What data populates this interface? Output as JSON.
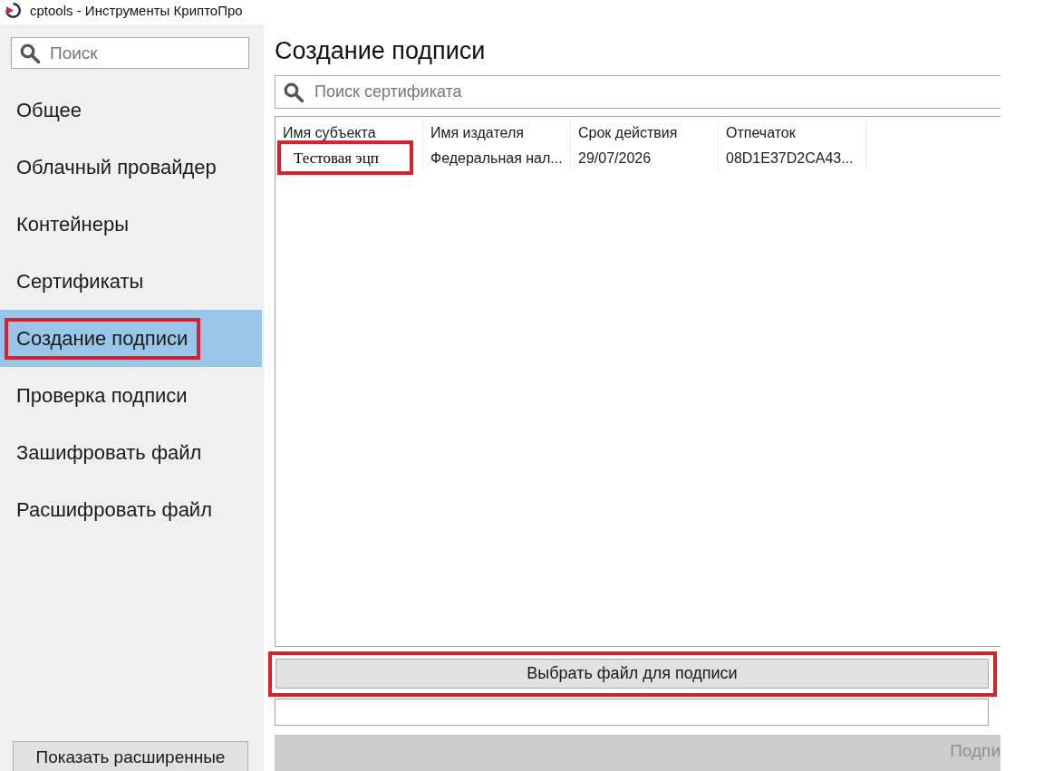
{
  "window": {
    "title": "cptools - Инструменты КриптоПро"
  },
  "sidebar": {
    "search": {
      "placeholder": "Поиск"
    },
    "items": [
      {
        "label": "Общее",
        "selected": false,
        "highlighted": false
      },
      {
        "label": "Облачный провайдер",
        "selected": false,
        "highlighted": false
      },
      {
        "label": "Контейнеры",
        "selected": false,
        "highlighted": false
      },
      {
        "label": "Сертификаты",
        "selected": false,
        "highlighted": false
      },
      {
        "label": "Создание подписи",
        "selected": true,
        "highlighted": true
      },
      {
        "label": "Проверка подписи",
        "selected": false,
        "highlighted": false
      },
      {
        "label": "Зашифровать файл",
        "selected": false,
        "highlighted": false
      },
      {
        "label": "Расшифровать файл",
        "selected": false,
        "highlighted": false
      }
    ],
    "advanced_button": {
      "label": "Показать расширенные"
    }
  },
  "main": {
    "heading": "Создание подписи",
    "search": {
      "placeholder": "Поиск сертификата"
    },
    "table": {
      "columns": [
        "Имя субъекта",
        "Имя издателя",
        "Срок действия",
        "Отпечаток"
      ],
      "rows": [
        {
          "cells": [
            {
              "text": "Тестовая эцп",
              "highlighted": true
            },
            {
              "text": "Федеральная нал...",
              "highlighted": false
            },
            {
              "text": "29/07/2026",
              "highlighted": false
            },
            {
              "text": "08D1E37D2CA43...",
              "highlighted": false
            }
          ]
        }
      ]
    },
    "choose_button": {
      "label": "Выбрать файл для подписи",
      "highlighted": true
    },
    "sign_button": {
      "label": "Подпи",
      "disabled": true
    }
  }
}
